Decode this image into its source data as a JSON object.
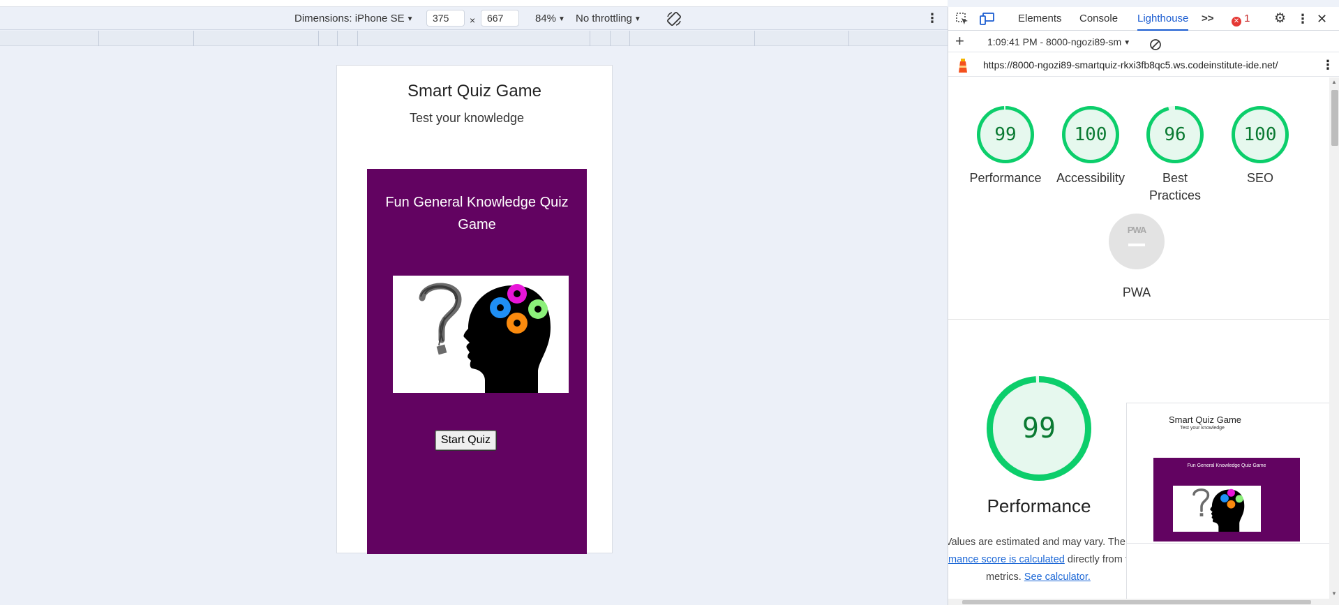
{
  "device_toolbar": {
    "dimensions_label": "Dimensions: iPhone SE",
    "width_value": "375",
    "times": "×",
    "height_value": "667",
    "zoom": "84%",
    "throttling": "No throttling"
  },
  "page": {
    "title": "Smart Quiz Game",
    "subtitle": "Test your knowledge",
    "panel_heading": "Fun General Knowledge Quiz Game",
    "start_button": "Start Quiz",
    "panel_color": "#620361"
  },
  "devtools": {
    "tabs": [
      {
        "label": "Elements"
      },
      {
        "label": "Console"
      },
      {
        "label": "Lighthouse"
      }
    ],
    "overflow": ">>",
    "error_count": "1",
    "report_select": "1:09:41 PM - 8000-ngozi89-sm",
    "url": "https://8000-ngozi89-smartquiz-rkxi3fb8qc5.ws.codeinstitute-ide.net/",
    "scores": [
      {
        "value": "99",
        "label_1": "Performance",
        "label_2": "",
        "fill": 0.99
      },
      {
        "value": "100",
        "label_1": "Accessibility",
        "label_2": "",
        "fill": 1.0
      },
      {
        "value": "96",
        "label_1": "Best",
        "label_2": "Practices",
        "fill": 0.96
      },
      {
        "value": "100",
        "label_1": "SEO",
        "label_2": "",
        "fill": 1.0
      }
    ],
    "pwa": {
      "badge": "PWA",
      "label": "PWA"
    },
    "big_score": {
      "value": "99",
      "label": "Performance",
      "fill": 0.99
    },
    "note_line_1": "Values are estimated and may vary. The",
    "note_link_1": "mance score is calculated",
    "note_line_2_rest": " directly from these",
    "note_line_3_prefix": "metrics.",
    "note_link_2": "See calculator.",
    "thumbnail": {
      "title": "Smart Quiz Game",
      "subtitle": "Test your knowledge",
      "heading": "Fun General Knowledge Quiz Game"
    },
    "colors": {
      "pass_green": "#0cce6b",
      "pass_bg": "#e6f8ee",
      "accent": "#1a5cd1"
    }
  }
}
